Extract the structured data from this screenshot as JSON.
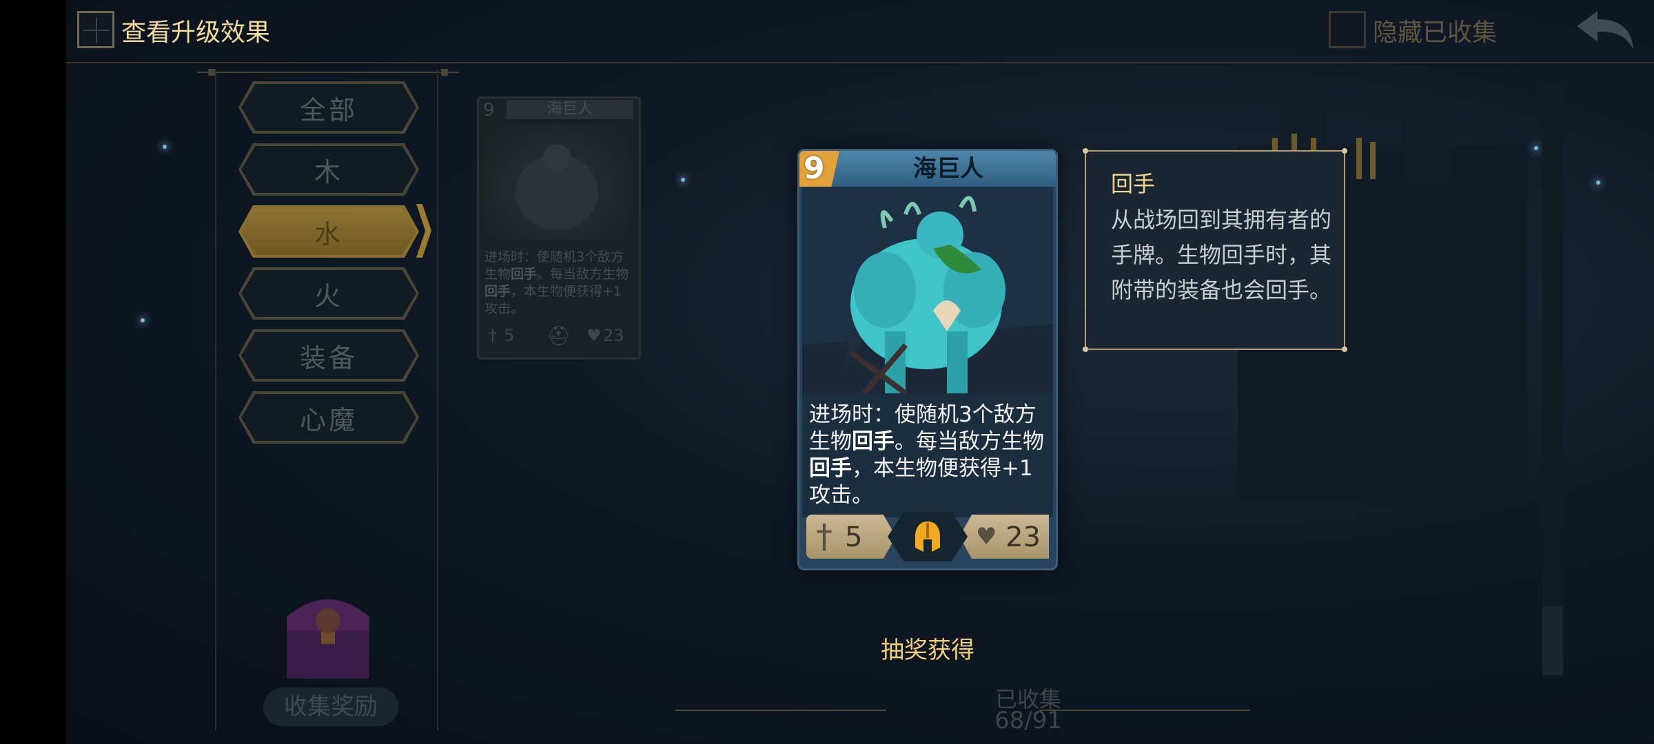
{
  "header": {
    "upgrade_label": "查看升级效果",
    "hide_collected_label": "隐藏已收集"
  },
  "sidebar": {
    "tabs": [
      {
        "label": "全部",
        "active": false
      },
      {
        "label": "木",
        "active": false
      },
      {
        "label": "水",
        "active": true
      },
      {
        "label": "火",
        "active": false
      },
      {
        "label": "装备",
        "active": false
      },
      {
        "label": "心魔",
        "active": false
      }
    ],
    "reward_label": "收集奖励"
  },
  "grid_card": {
    "cost": "9",
    "name": "海巨人",
    "desc_parts": [
      "进场时：使随机3个敌方生物",
      "回手",
      "。每当敌方生物",
      "回手",
      "，本生物便获得+1攻击。"
    ],
    "attack": "5",
    "health": "23"
  },
  "card": {
    "cost": "9",
    "name": "海巨人",
    "desc_parts": [
      "进场时：使随机3个敌方生物",
      "回手",
      "。每当敌方生物",
      "回手",
      "，本生物便获得+1攻击。"
    ],
    "attack": "5",
    "health": "23",
    "class_icon": "helmet-icon"
  },
  "tooltip": {
    "title": "回手",
    "body": "从战场回到其拥有者的手牌。生物回手时，其附带的装备也会回手。"
  },
  "obtain_label": "抽奖获得",
  "collection": {
    "title": "已收集",
    "count": "68/91"
  },
  "colors": {
    "accent_gold": "#f1dba0",
    "active_tab": "#8a7030",
    "card_blue": "#28445c",
    "cost_orange": "#e2a43a"
  }
}
